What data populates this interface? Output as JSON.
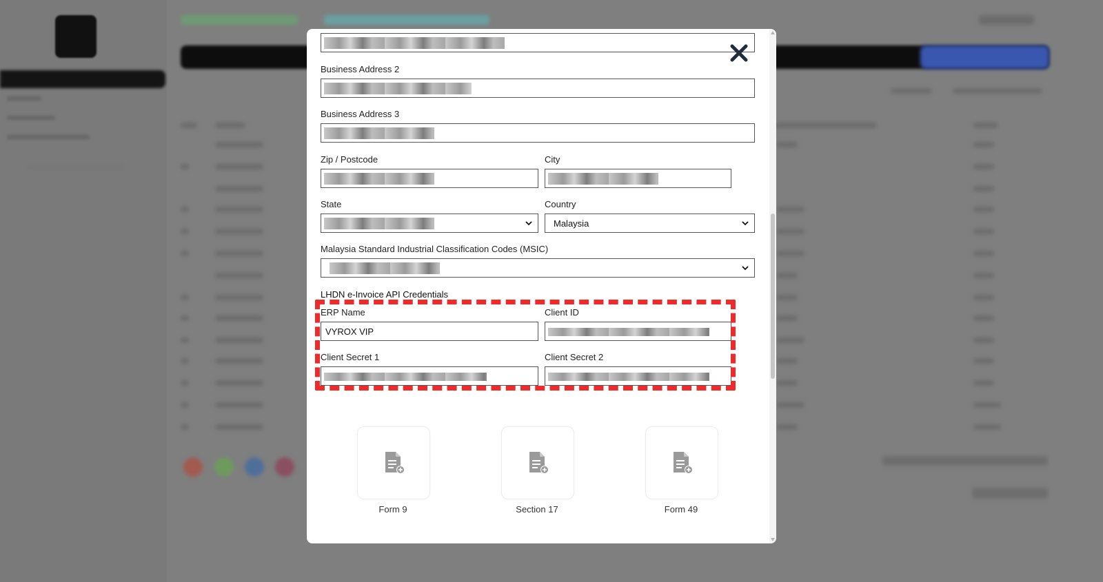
{
  "modal": {
    "close_icon": "close-x-icon",
    "fields": {
      "address2_label": "Business Address 2",
      "address3_label": "Business Address 3",
      "zip_label": "Zip / Postcode",
      "city_label": "City",
      "state_label": "State",
      "country_label": "Country",
      "country_value": "Malaysia",
      "msic_label": "Malaysia Standard Industrial Classification Codes (MSIC)"
    },
    "credentials": {
      "section_title": "LHDN e-Invoice API Credentials",
      "erp_name_label": "ERP Name",
      "erp_name_value": "VYROX VIP",
      "client_id_label": "Client ID",
      "client_secret1_label": "Client Secret 1",
      "client_secret2_label": "Client Secret 2"
    },
    "forms": [
      {
        "label": "Form 9",
        "icon": "document-add-icon"
      },
      {
        "label": "Section 17",
        "icon": "document-add-icon"
      },
      {
        "label": "Form 49",
        "icon": "document-add-icon"
      }
    ]
  },
  "colors": {
    "highlight": "#ee2a2a",
    "overlay": "#7f7f7f",
    "icon_gray": "#9a9a9a"
  }
}
